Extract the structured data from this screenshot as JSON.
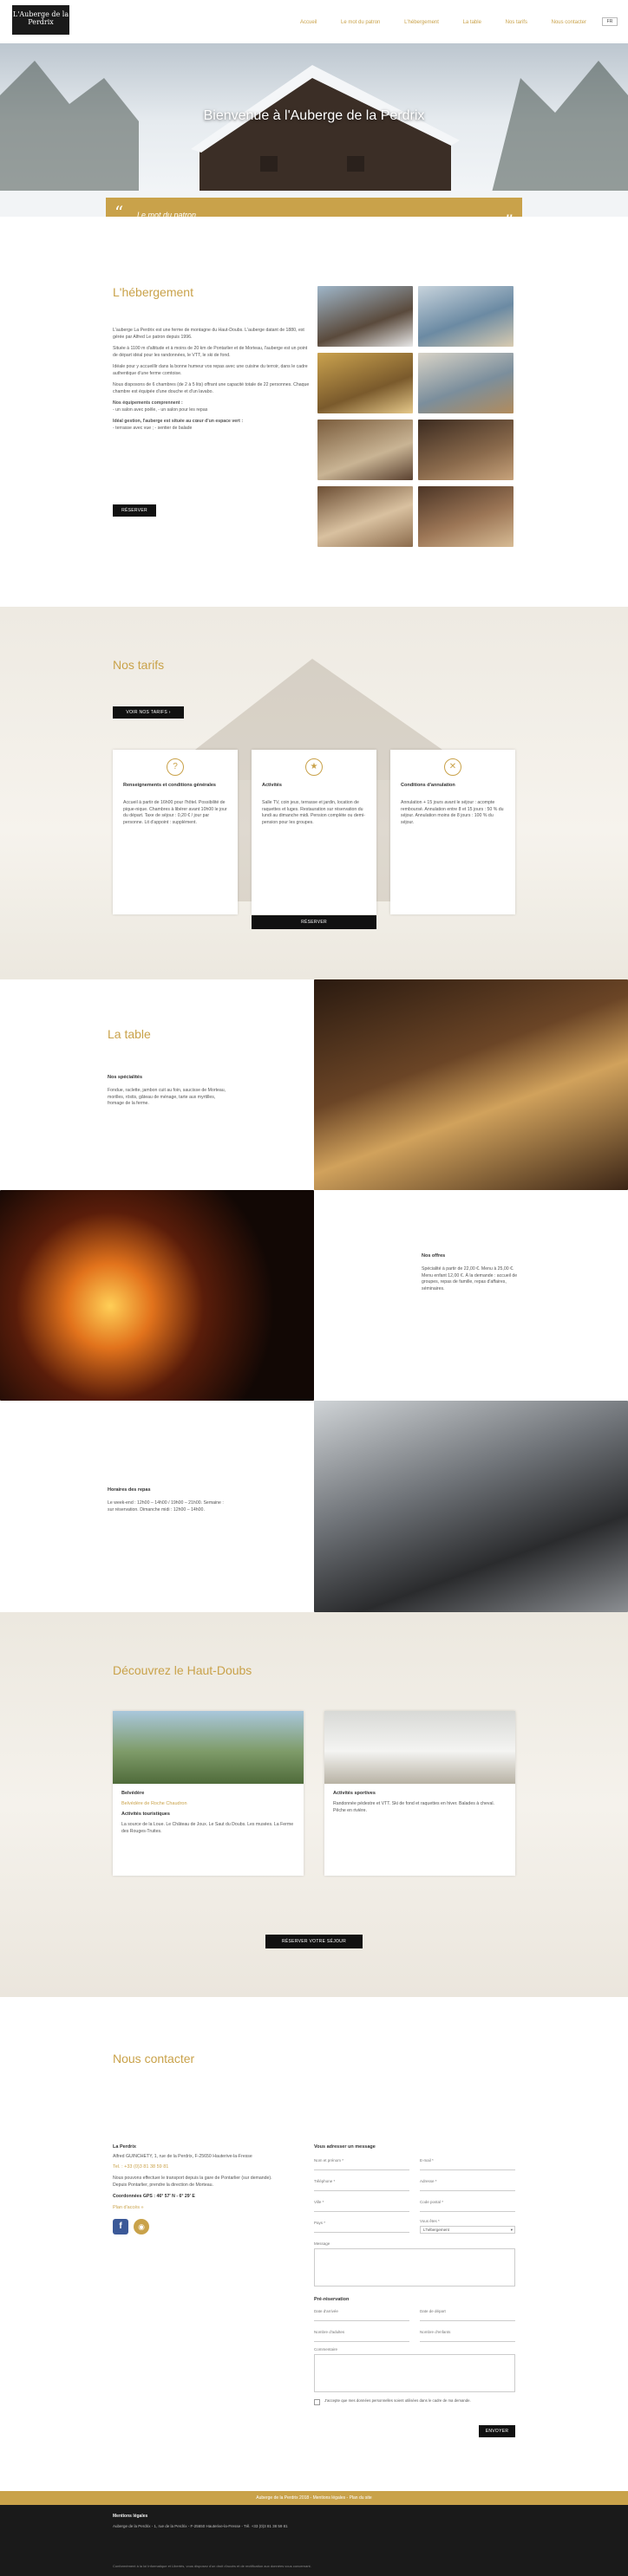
{
  "nav": {
    "logo_text": "L'Auberge de la Perdrix",
    "items": [
      "Accueil",
      "Le mot du patron",
      "L'hébergement",
      "La table",
      "Nos tarifs",
      "Nous contacter"
    ],
    "lang": "FR"
  },
  "hero": {
    "title": "Bienvenue à l'Auberge de la Perdrix",
    "quote_label": "Le mot du patron",
    "quote_open": "“",
    "quote_close": "”"
  },
  "hebergement": {
    "title": "L'hébergement",
    "p1": "L'auberge La Perdrix est une ferme de montagne du Haut-Doubs. L'auberge datant de 1880, est gérée par Alfred Le patron depuis 1996.",
    "p2": "Située à 1100 m d'altitude et à moins de 20 km de Pontarlier et de Morteau, l'auberge est un point de départ idéal pour les randonnées, le VTT, le ski de fond.",
    "p3": "Idéale pour y accueillir dans la bonne humeur vos repas avec une cuisine du terroir, dans le cadre authentique d'une ferme comtoise.",
    "p4": "Nous disposons de 6 chambres (de 2 à 5 lits) offrant une capacité totale de 22 personnes. Chaque chambre est équipée d'une douche et d'un lavabo.",
    "equip_title": "Nos équipements comprennent :",
    "equip_list": "- un salon avec poêle, - un salon pour les repas",
    "ideal_title": "Idéal gestion, l'auberge est située au cœur d'un espace vert :",
    "ideal_list": "- terrasse avec vue ; - sentier de balade",
    "button": "Réserver"
  },
  "tarifs": {
    "title": "Nos tarifs",
    "button": "Voir nos tarifs",
    "cards": [
      {
        "icon": "?",
        "title": "Renseignements et conditions générales",
        "text": "Accueil à partir de 16h00 pour l'hôtel. Possibilité de pique-nique. Chambres à libérer avant 10h00 le jour du départ. Taxe de séjour : 0,20 € / jour par personne. Lit d'appoint : supplément."
      },
      {
        "icon": "★",
        "title": "Activités",
        "text": "Salle TV, coin jeux, terrasse et jardin, location de raquettes et luges. Restauration sur réservation du lundi au dimanche midi. Pension complète ou demi-pension pour les groupes."
      },
      {
        "icon": "✕",
        "title": "Conditions d'annulation",
        "text": "Annulation + 15 jours avant le séjour : acompte remboursé. Annulation entre 8 et 15 jours : 50 % du séjour. Annulation moins de 8 jours : 100 % du séjour."
      }
    ],
    "reserve_button": "Réserver"
  },
  "table": {
    "title": "La table",
    "spec_title": "Nos spécialités",
    "spec_text": "Fondue, raclette, jambon cuit au foin, saucisse de Morteau, morilles, röstis, gâteau de ménage, tarte aux myrtilles, fromage de la ferme.",
    "offer_title": "Nos offres",
    "offer_text": "Spécialité à partir de 22,00 €. Menu à 25,00 €. Menu enfant 12,00 €. À la demande : accueil de groupes, repas de famille, repas d'affaires, séminaires.",
    "hours_title": "Horaires des repas",
    "hours_text": "Le week-end : 12h00 – 14h00 / 19h00 – 21h00. Semaine : sur réservation. Dimanche midi : 12h00 – 14h00."
  },
  "decouvrez": {
    "title": "Découvrez le Haut-Doubs",
    "card1_label": "Belvédère",
    "card1_link": "Belvédère de Roche Chaudron",
    "card1_sub": "Activités touristiques",
    "card1_text": "La source de la Loue. Le Château de Joux. Le Saut du Doubs. Les musées. La Ferme des Rouges-Truites.",
    "card2_label": "Activités sportives",
    "card2_text": "Randonnée pédestre et VTT. Ski de fond et raquettes en hiver. Balades à cheval. Pêche en rivière.",
    "button": "Réserver votre séjour"
  },
  "contact": {
    "title": "Nous contacter",
    "name": "La Perdrix",
    "address": "Alfred GUINCHETY, 1, rue de la Perdrix, F-25650 Hauterive-la-Fresse",
    "phone": "Tel. : +33 (0)3 81 38 59 81",
    "directions": "Nous pouvons effectuer le transport depuis la gare de Pontarlier (sur demande). Depuis Pontarlier, prendre la direction de Morteau.",
    "gps": "Coordonnées GPS : 46° 57' N - 6° 29' E",
    "plan_link": "Plan d'accès »",
    "form_title": "Vous adresser un message",
    "fields": [
      "Nom et prénom *",
      "E-mail *",
      "Téléphone *",
      "Adresse *",
      "Ville *",
      "Code postal *",
      "Pays *",
      "Vous êtes *"
    ],
    "select_value": "L'hébergement",
    "message_label": "Message",
    "reservation_title": "Pré-réservation",
    "res_fields": [
      "Date d'arrivée",
      "Date de départ",
      "Nombre d'adultes",
      "Nombre d'enfants"
    ],
    "comment_label": "Commentaire",
    "consent": "J'accepte que mes données personnelles soient utilisées dans le cadre de ma demande.",
    "send": "Envoyer"
  },
  "footer": {
    "links": "Auberge de la Perdrix 2018 - Mentions légales - Plan du site",
    "credits_title": "Mentions légales",
    "credits_text": "Auberge de la Perdrix - 1, rue de la Perdrix - F-25650 Hauterive-la-Fresse - Tél. +33 (0)3 81 38 59 81",
    "bottom": "Conformément à la loi Informatique et Libertés, vous disposez d'un droit d'accès et de rectification aux données vous concernant."
  },
  "colors": {
    "accent": "#c9a24a",
    "dark": "#111111",
    "page_bg": "#ffffff"
  }
}
